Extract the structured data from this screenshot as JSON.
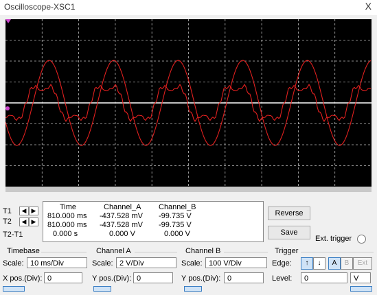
{
  "window": {
    "title": "Oscilloscope-XSC1",
    "close_glyph": "X"
  },
  "cursors": {
    "t1_label": "T1",
    "t2_label": "T2",
    "diff_label": "T2-T1",
    "arrow_left": "◀",
    "arrow_right": "▶"
  },
  "readout": {
    "headers": [
      "Time",
      "Channel_A",
      "Channel_B"
    ],
    "rows": [
      [
        "810.000 ms",
        "-437.528 mV",
        "-99.735 V"
      ],
      [
        "810.000 ms",
        "-437.528 mV",
        "-99.735 V"
      ],
      [
        "0.000 s",
        "0.000 V",
        "0.000 V"
      ]
    ]
  },
  "buttons": {
    "reverse": "Reverse",
    "save": "Save",
    "ext_trigger": "Ext. trigger"
  },
  "timebase": {
    "title": "Timebase",
    "scale_label": "Scale:",
    "scale_value": "10 ms/Div",
    "xpos_label": "X pos.(Div):",
    "xpos_value": "0"
  },
  "channel_a": {
    "title": "Channel A",
    "scale_label": "Scale:",
    "scale_value": "2  V/Div",
    "ypos_label": "Y pos.(Div):",
    "ypos_value": "0"
  },
  "channel_b": {
    "title": "Channel B",
    "scale_label": "Scale:",
    "scale_value": "100  V/Div",
    "ypos_label": "Y pos.(Div):",
    "ypos_value": "0"
  },
  "trigger": {
    "title": "Trigger",
    "edge_label": "Edge:",
    "level_label": "Level:",
    "level_value": "0",
    "level_unit": "V",
    "rise_glyph": "↑",
    "fall_glyph": "↓",
    "src_a": "A",
    "src_b": "B",
    "src_ext": "Ext"
  },
  "colors": {
    "screen_bg": "#000000",
    "trace": "#e0201f",
    "grid": "#bdbdbd",
    "marker": "#cc44cc"
  }
}
